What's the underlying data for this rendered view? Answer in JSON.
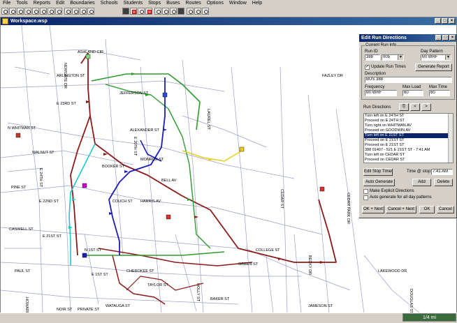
{
  "menu": [
    "File",
    "Tools",
    "Reports",
    "Edit",
    "Boundaries",
    "Schools",
    "Students",
    "Stops",
    "Buses",
    "Routes",
    "Options",
    "Window",
    "Help"
  ],
  "workspace": {
    "title": "Workspace.wsp"
  },
  "scale_label": "1/4 mi",
  "colors": {
    "route_dark_red": "#8b1a1a",
    "route_red": "#cc2a1a",
    "route_green": "#2e9b2e",
    "route_blue": "#1d1db8",
    "route_cyan": "#1ec8c8",
    "route_yellow": "#e8d020",
    "highlight": "#cc00cc",
    "street": "#9aa0c8"
  },
  "streets": [
    {
      "name": "ASHLAND CIR"
    },
    {
      "name": "NEWGATE DR"
    },
    {
      "name": "ARLINGTON ST"
    },
    {
      "name": "JEFFERSON ST"
    },
    {
      "name": "N WHITMAN ST"
    },
    {
      "name": "E 24TH ST"
    },
    {
      "name": "E 23RD ST"
    },
    {
      "name": "E 22ND ST"
    },
    {
      "name": "E 21ST ST"
    },
    {
      "name": "E 20TH ST"
    },
    {
      "name": "ALEXANDER ST"
    },
    {
      "name": "BOOKER ST"
    },
    {
      "name": "CHEROKEE ST"
    },
    {
      "name": "LAUREL ST"
    },
    {
      "name": "N 1ST ST"
    },
    {
      "name": "E 1ST ST"
    },
    {
      "name": "PAUL ST"
    },
    {
      "name": "HOWARD ST"
    },
    {
      "name": "WATAUGA ST"
    },
    {
      "name": "NOIR ST"
    },
    {
      "name": "PRIVATE ST"
    },
    {
      "name": "CEDAR ST"
    },
    {
      "name": "LAKEWOOD DR"
    },
    {
      "name": "HARRIS AV"
    },
    {
      "name": "PINE ST"
    },
    {
      "name": "BECKY DR"
    },
    {
      "name": "FAZLEY DR"
    },
    {
      "name": "MONROE ST"
    },
    {
      "name": "COLLEGE ST"
    },
    {
      "name": "DOUGLAS ST"
    },
    {
      "name": "TAYLOR ST"
    },
    {
      "name": "WALNUT ST"
    },
    {
      "name": "CASWELL ST"
    },
    {
      "name": "HOLLY ST"
    },
    {
      "name": "COUCH ST"
    },
    {
      "name": "BAKER ST"
    },
    {
      "name": "JAMESON ST"
    },
    {
      "name": "CEDAR PARK DR"
    },
    {
      "name": "BELL AV"
    },
    {
      "name": "GREEN ST"
    }
  ],
  "dialog": {
    "title": "Edit Run Directions",
    "current_run_info": "Current Run Info",
    "run_id_label": "Run ID",
    "run_id_value": "388",
    "run_id_value2": "005",
    "day_pattern_label": "Day Pattern",
    "day_pattern_value": "MTWRF",
    "update_run_times_label": "Update Run Times",
    "generate_report_label": "Generate Report",
    "description_label": "Description",
    "description_value": "BUS 388",
    "frequency_label": "Frequency",
    "frequency_value": "MTWRF",
    "max_load_label": "Max Load",
    "max_load_value": "60",
    "max_time_label": "Max Time",
    "max_time_value": "60",
    "run_directions_label": "Run Directions",
    "directions": [
      "Turn left on E 24TH ST",
      "Proceed on E 24TH ST",
      "Turn right on WHITMAN AV",
      "Proceed on GOODWIN AV",
      "Turn left on E 21ST ST",
      "Proceed on E 21ST ST",
      "Proceed on E 21ST ST",
      "388 01407 - 521 E 21ST ST - 7:41 AM",
      "Turn left on CEDAR ST",
      "Proceed on CEDAR ST"
    ],
    "selected_index": 4,
    "edit_stop_times_label": "Edit Stop Times",
    "time_at_stop_label": "Time @ stop:",
    "time_at_stop_value": "7:41 AM",
    "auto_generate_label": "Auto Generate",
    "add_label": "Add",
    "delete_label": "Delete",
    "make_explicit_label": "Make Explicit Directions",
    "auto_generate_all_label": "Auto generate for all day patterns",
    "ok_next_label": "OK + Next",
    "cancel_next_label": "Cancel + Next",
    "ok_label": "OK",
    "cancel_label": "Cancel"
  }
}
